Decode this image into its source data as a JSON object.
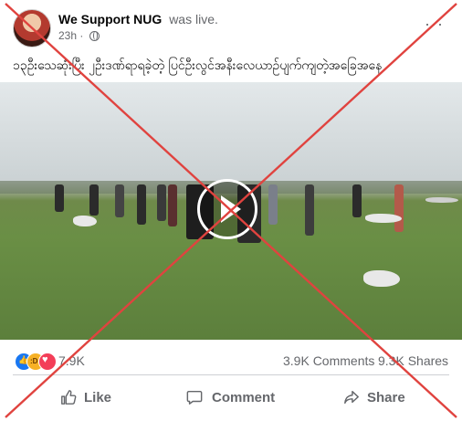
{
  "post": {
    "page_name": "We Support NUG",
    "status": "was live.",
    "time": "23h",
    "more": "···",
    "caption": "၁၃ဦးသေဆုံးပြီး ၂ဦးဒဏ်ရာရခဲ့တဲ့ ပြင်ဦးလွင်အနီးလေယာဉ်ပျက်ကျတဲ့အခြေအနေ"
  },
  "stats": {
    "reaction_count": "7.9K",
    "comments": "3.9K Comments",
    "shares": "9.3K Shares"
  },
  "actions": {
    "like": "Like",
    "comment": "Comment",
    "share": "Share"
  },
  "colors": {
    "overlay_x": "#e0433f",
    "accent": "#1877f2"
  },
  "icons": {
    "privacy": "globe-icon",
    "like": "thumbs-up-icon",
    "comment": "speech-bubble-icon",
    "share": "share-arrow-icon"
  }
}
